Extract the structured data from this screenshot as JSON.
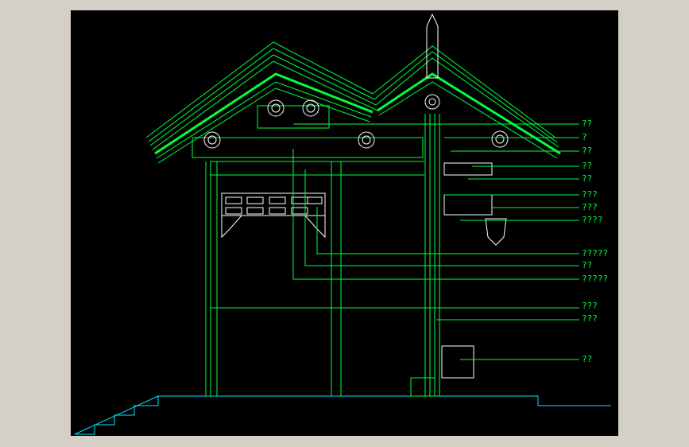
{
  "app": {
    "background_color": "#d4d0c8",
    "canvas_color": "#000000"
  },
  "colors": {
    "cyan": "#00e5ff",
    "green": "#00ff3c",
    "white": "#ffffff"
  },
  "drawing": {
    "title": "",
    "labels": [
      {
        "id": "l1",
        "text": "??"
      },
      {
        "id": "l2",
        "text": "?"
      },
      {
        "id": "l3",
        "text": "??"
      },
      {
        "id": "l4",
        "text": "??"
      },
      {
        "id": "l5",
        "text": "??"
      },
      {
        "id": "l6",
        "text": "???"
      },
      {
        "id": "l7",
        "text": "???"
      },
      {
        "id": "l8",
        "text": "????"
      },
      {
        "id": "l9",
        "text": "?????"
      },
      {
        "id": "l10",
        "text": "??"
      },
      {
        "id": "l11",
        "text": "?????"
      },
      {
        "id": "l12",
        "text": "???"
      },
      {
        "id": "l13",
        "text": "???"
      },
      {
        "id": "l14",
        "text": "??"
      }
    ]
  }
}
